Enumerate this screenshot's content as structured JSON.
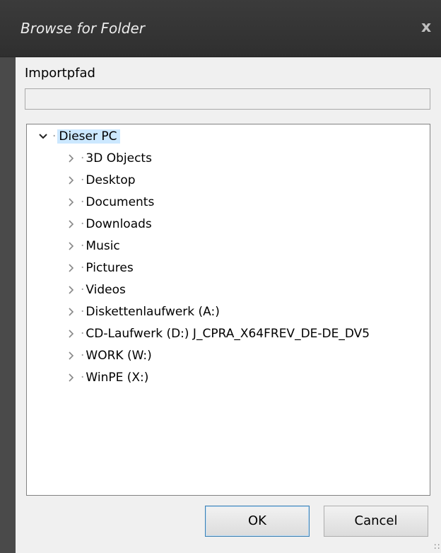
{
  "dialog": {
    "title": "Browse for Folder",
    "close_label": "x"
  },
  "import": {
    "label": "Importpfad",
    "value": ""
  },
  "tree": {
    "root": "Dieser PC",
    "items": [
      "3D Objects",
      "Desktop",
      "Documents",
      "Downloads",
      "Music",
      "Pictures",
      "Videos",
      "Diskettenlaufwerk (A:)",
      "CD-Laufwerk (D:) J_CPRA_X64FREV_DE-DE_DV5",
      "WORK (W:)",
      "WinPE (X:)"
    ]
  },
  "buttons": {
    "ok": "OK",
    "cancel": "Cancel"
  },
  "colors": {
    "selection": "#cce8ff",
    "titlebar": "#333333"
  }
}
